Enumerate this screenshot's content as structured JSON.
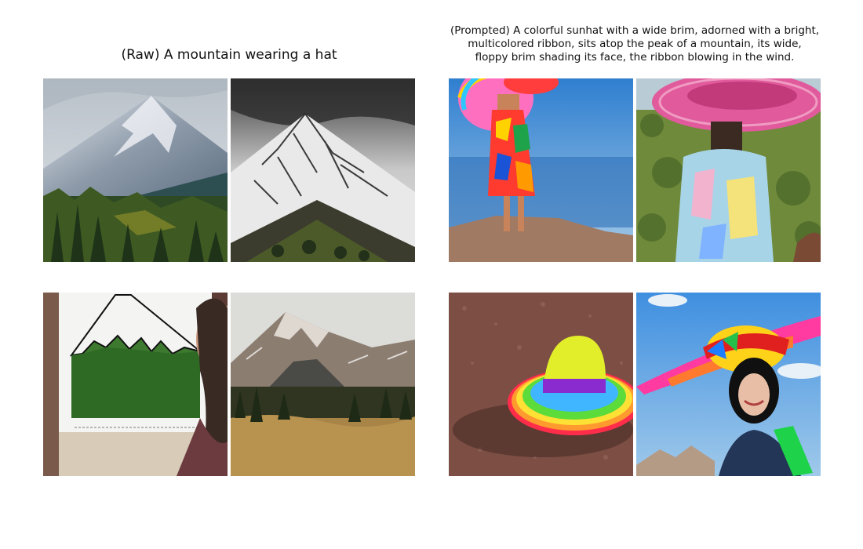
{
  "panels": {
    "raw": {
      "title": "(Raw) A mountain wearing a hat"
    },
    "prompted": {
      "title_lines": [
        "(Prompted) A colorful sunhat with a wide brim, adorned with a bright,",
        "multicolored ribbon, sits atop the peak of a mountain, its wide,",
        "floppy brim shading its face, the ribbon blowing in the wind."
      ]
    }
  }
}
